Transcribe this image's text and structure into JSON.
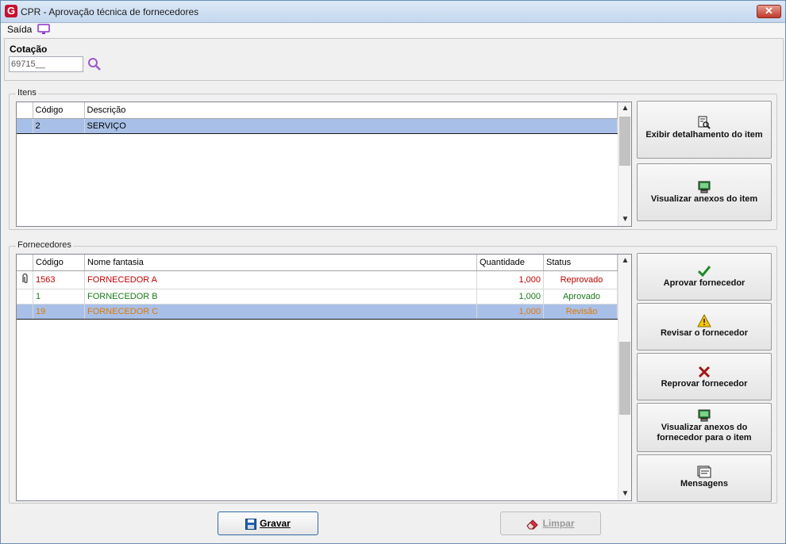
{
  "window": {
    "title": "CPR - Aprovação técnica de fornecedores",
    "close": "✕"
  },
  "menu": {
    "saida": "Saída"
  },
  "cotacao": {
    "label": "Cotação",
    "value": "69715__"
  },
  "itens": {
    "group_label": "Itens",
    "columns": {
      "codigo": "Código",
      "descricao": "Descrição"
    },
    "rows": [
      {
        "codigo": "2",
        "descricao": "SERVIÇO"
      }
    ]
  },
  "fornecedores": {
    "group_label": "Fornecedores",
    "columns": {
      "codigo": "Código",
      "nome": "Nome fantasia",
      "quantidade": "Quantidade",
      "status": "Status"
    },
    "rows": [
      {
        "codigo": "1563",
        "nome": "FORNECEDOR A",
        "quantidade": "1,000",
        "status": "Reprovado",
        "color": "#c00000"
      },
      {
        "codigo": "1",
        "nome": "FORNECEDOR B",
        "quantidade": "1,000",
        "status": "Aprovado",
        "color": "#1b7a1b"
      },
      {
        "codigo": "19",
        "nome": "FORNECEDOR C",
        "quantidade": "1,000",
        "status": "Revisão",
        "color": "#e07800"
      }
    ]
  },
  "actions": {
    "exibir_detalhamento": "Exibir detalhamento do item",
    "visualizar_anexos_item": "Visualizar anexos do item",
    "aprovar": "Aprovar fornecedor",
    "revisar": "Revisar o fornecedor",
    "reprovar": "Reprovar fornecedor",
    "visualizar_anexos_fornecedor_1": "Visualizar anexos do",
    "visualizar_anexos_fornecedor_2": "fornecedor para o item",
    "mensagens": "Mensagens"
  },
  "buttons": {
    "gravar": "Gravar",
    "limpar": "Limpar"
  }
}
